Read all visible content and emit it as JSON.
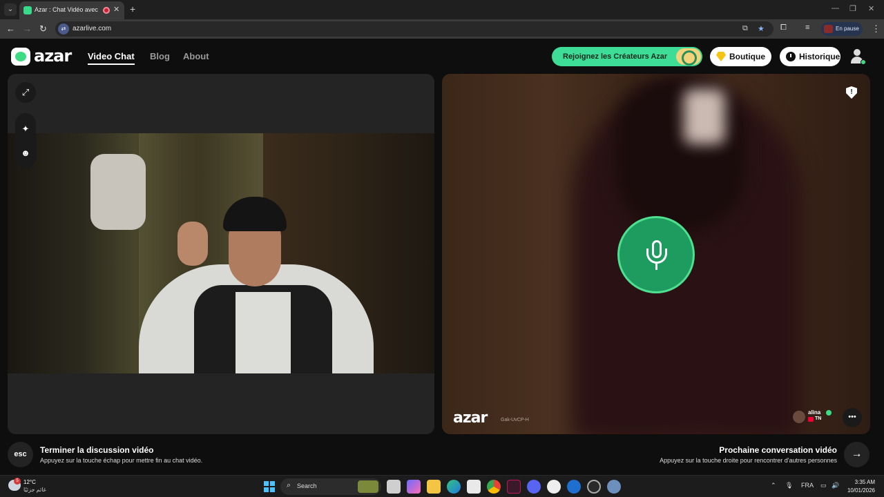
{
  "browser": {
    "tab_title": "Azar : Chat Vidéo avec de n",
    "url": "azarlive.com",
    "profile_status": "En pause"
  },
  "site": {
    "logo": "azar",
    "nav": [
      "Video Chat",
      "Blog",
      "About"
    ],
    "creators_button": "Rejoignez les Créateurs Azar",
    "shop_button": "Boutique",
    "history_button": "Historique"
  },
  "remote": {
    "watermark": "azar",
    "watermark_id": "Gak-UvCP-H",
    "user_name": "alina",
    "country_code": "TN"
  },
  "bottom": {
    "esc_key": "esc",
    "end_title": "Terminer la discussion vidéo",
    "end_subtitle": "Appuyez sur la touche échap pour mettre fin au chat vidéo.",
    "next_title": "Prochaine conversation vidéo",
    "next_subtitle": "Appuyez sur la touche droite pour rencontrer d'autres personnes"
  },
  "taskbar": {
    "temperature": "12°C",
    "weather_desc": "غائم جزئيًا",
    "weather_badge": "5",
    "search_placeholder": "Search",
    "language": "FRA",
    "time": "3:35 AM",
    "date": "10/01/2026"
  },
  "colors": {
    "accent_green": "#3ddc97",
    "mic_green": "#1e9b5f",
    "page_bg": "#0e0e0e"
  }
}
